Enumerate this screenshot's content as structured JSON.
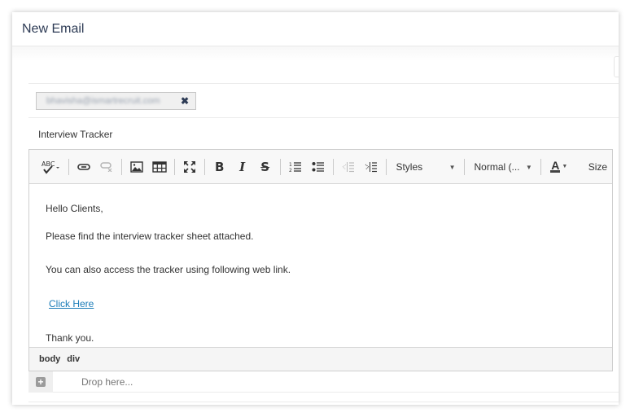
{
  "modal": {
    "title": "New Email"
  },
  "recipients": [
    {
      "email": "bhavisha@ismartrecruit.com",
      "remove_icon": "close-icon"
    }
  ],
  "subject": "Interview Tracker",
  "toolbar": {
    "buttons": [
      {
        "name": "spellcheck",
        "icon": "spellcheck-icon",
        "enabled": true
      },
      {
        "name": "link",
        "icon": "link-icon",
        "enabled": true
      },
      {
        "name": "unlink",
        "icon": "unlink-icon",
        "enabled": false
      },
      {
        "name": "image",
        "icon": "image-icon",
        "enabled": true
      },
      {
        "name": "table",
        "icon": "table-icon",
        "enabled": true
      },
      {
        "name": "maximize",
        "icon": "maximize-icon",
        "enabled": true
      },
      {
        "name": "bold",
        "label": "B",
        "enabled": true
      },
      {
        "name": "italic",
        "label": "I",
        "enabled": true
      },
      {
        "name": "strike",
        "label": "S",
        "enabled": true
      },
      {
        "name": "numbered-list",
        "icon": "numbered-list-icon",
        "enabled": true
      },
      {
        "name": "bulleted-list",
        "icon": "bulleted-list-icon",
        "enabled": true
      },
      {
        "name": "outdent",
        "icon": "outdent-icon",
        "enabled": false
      },
      {
        "name": "indent",
        "icon": "indent-icon",
        "enabled": true
      },
      {
        "name": "text-color",
        "label": "A",
        "enabled": true
      }
    ],
    "styles_label": "Styles",
    "format_label": "Normal (...",
    "size_label": "Size",
    "bold_label": "B",
    "italic_label": "I",
    "strike_label": "S",
    "color_label": "A"
  },
  "body": {
    "greeting": "Hello Clients,",
    "line1": "Please find the interview tracker sheet attached.",
    "line2": "You can also access the tracker using following web link.",
    "link_text": "Click Here",
    "closing": "Thank you."
  },
  "path_bar": [
    "body",
    "div"
  ],
  "drop_zone": {
    "text": "Drop here...",
    "icon": "plus-icon"
  },
  "colors": {
    "title": "#2d3b55",
    "link": "#1a7cb8",
    "toolbar_bg": "#f8f8f8"
  }
}
